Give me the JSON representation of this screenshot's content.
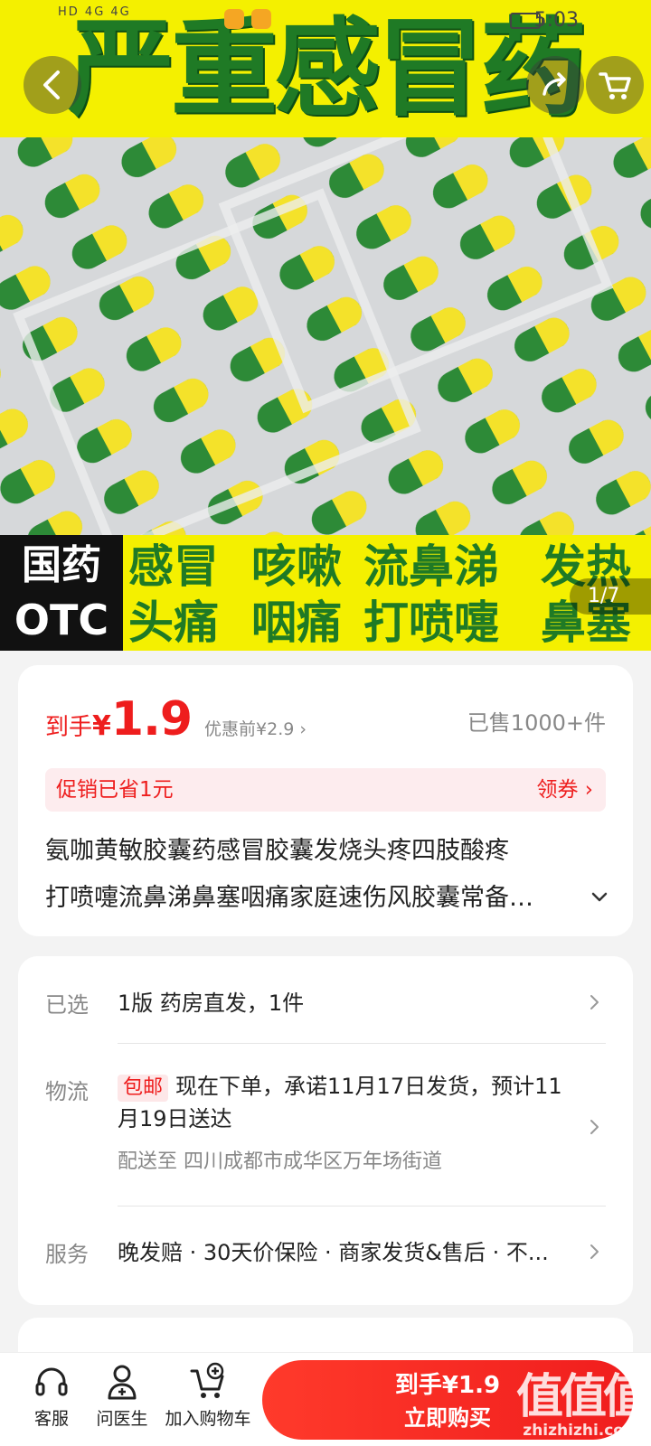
{
  "status_bar": {
    "left": "HD 4G 4G",
    "time": "5:03"
  },
  "hero": {
    "title": "严重感冒药",
    "otc_line1": "国药",
    "otc_line2": "OTC",
    "symptoms": [
      "感冒",
      "咳嗽",
      "流鼻涕",
      "发热",
      "头痛",
      "咽痛",
      "打喷嚏",
      "鼻塞"
    ],
    "pager": "1/7"
  },
  "price": {
    "prefix": "到手",
    "currency": "¥",
    "value": "1.9",
    "original": "优惠前¥2.9 ›",
    "sold": "已售1000+件"
  },
  "promo": {
    "text": "促销已省1元",
    "coupon": "领券 ›"
  },
  "product": {
    "title_line1": "氨咖黄敏胶囊药感冒胶囊发烧头疼四肢酸疼",
    "title_line2": "打喷嚏流鼻涕鼻塞咽痛家庭速伤风胶囊常备…"
  },
  "spec": {
    "selected_label": "已选",
    "selected_value": "1版 药房直发，1件",
    "logistics_label": "物流",
    "free_shipping": "包邮",
    "logistics_value": "现在下单，承诺11月17日发货，预计11月19日送达",
    "ship_to": "配送至  四川成都市成华区万年场街道",
    "service_label": "服务",
    "service_value": "晚发赔 · 30天价保险 · 商家发货&售后 · 不..."
  },
  "bottom": {
    "service": "客服",
    "doctor": "问医生",
    "add_cart": "加入购物车",
    "buy_price": "到手¥1.9",
    "buy_now": "立即购买"
  },
  "watermark": {
    "big": "值值值",
    "small": "zhizhizhi.com"
  },
  "colors": {
    "accent": "#ee1d1d",
    "brand_green": "#1f7a25",
    "banner_yellow": "#f4f000"
  }
}
